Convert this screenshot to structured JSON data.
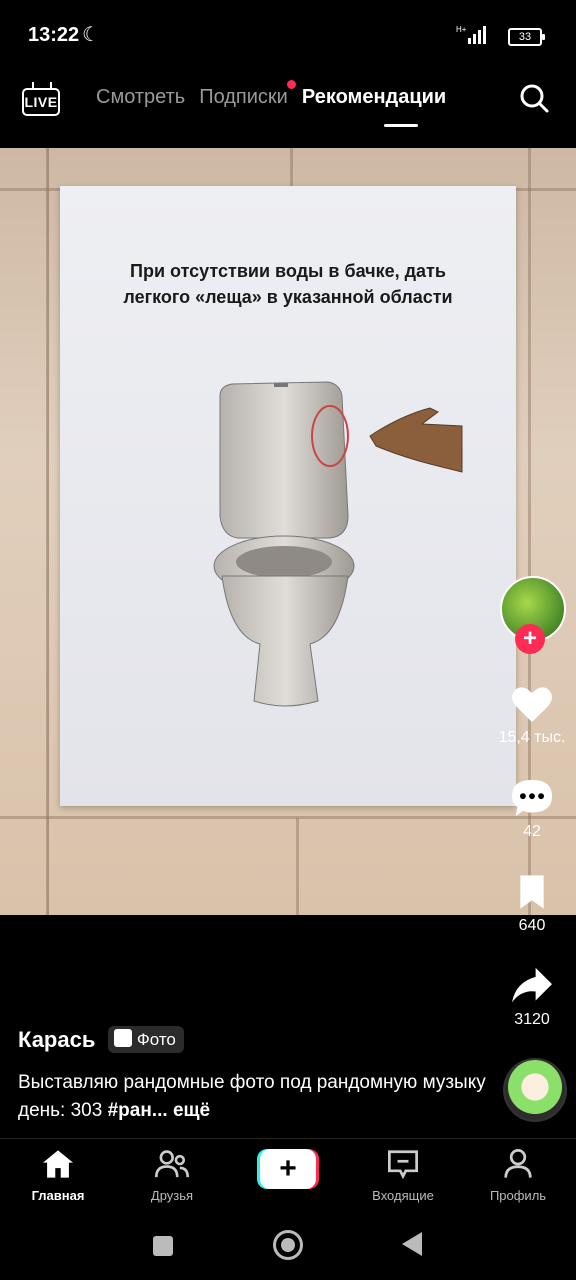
{
  "status_bar": {
    "time": "13:22",
    "network": "H+",
    "battery": "33"
  },
  "top_nav": {
    "live_label": "LIVE",
    "tabs": [
      {
        "label": "Смотреть"
      },
      {
        "label": "Подписки"
      },
      {
        "label": "Рекомендации"
      }
    ]
  },
  "post": {
    "image_text": "При отсутствии воды в бачке, дать легкого «леща» в указанной области",
    "likes": "15,4 тыс.",
    "comments": "42",
    "saves": "640",
    "shares": "3120",
    "author": "Карась",
    "badge": "Фото",
    "description_text": "Выставляю рандомные фото под рандомную музыку день: 303 ",
    "hashtag": "#ран...",
    "more": "ещё"
  },
  "bottom_nav": {
    "home": "Главная",
    "friends": "Друзья",
    "create": "+",
    "inbox": "Входящие",
    "profile": "Профиль"
  },
  "colors": {
    "accent": "#fe2c55",
    "cyan": "#25f4ee"
  },
  "icons": [
    "moon-icon",
    "signal-icon",
    "battery-icon",
    "live-icon",
    "search-icon",
    "heart-icon",
    "comment-icon",
    "bookmark-icon",
    "share-icon",
    "home-icon",
    "friends-icon",
    "inbox-icon",
    "profile-icon"
  ]
}
